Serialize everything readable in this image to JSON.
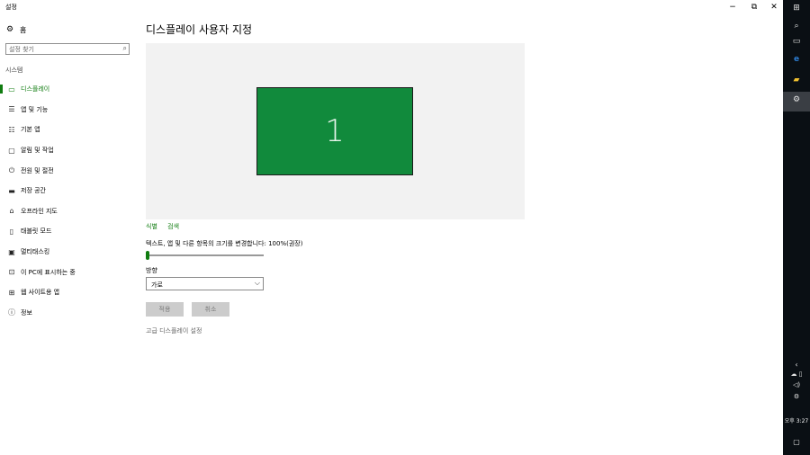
{
  "window": {
    "app_title": "설정",
    "minimize": "−",
    "restore": "⧉",
    "close": "✕"
  },
  "sidebar": {
    "home_label": "홈",
    "search_placeholder": "설정 찾기",
    "section_label": "시스템",
    "items": [
      {
        "label": "디스플레이",
        "icon": "monitor-icon",
        "active": true
      },
      {
        "label": "앱 및 기능",
        "icon": "list-icon"
      },
      {
        "label": "기본 앱",
        "icon": "list-bullet-icon"
      },
      {
        "label": "알림 및 작업",
        "icon": "message-icon"
      },
      {
        "label": "전원 및 절전",
        "icon": "power-icon"
      },
      {
        "label": "저장 공간",
        "icon": "storage-icon"
      },
      {
        "label": "오프라인 지도",
        "icon": "map-icon"
      },
      {
        "label": "태블릿 모드",
        "icon": "tablet-icon"
      },
      {
        "label": "멀티태스킹",
        "icon": "multitask-icon"
      },
      {
        "label": "이 PC에 표시하는 중",
        "icon": "project-icon"
      },
      {
        "label": "웹 사이트용 앱",
        "icon": "web-app-icon"
      },
      {
        "label": "정보",
        "icon": "info-icon"
      }
    ]
  },
  "main": {
    "page_title": "디스플레이 사용자 지정",
    "monitor_number": "1",
    "identify_link": "식별",
    "detect_link": "검색",
    "scale_label": "텍스트, 앱 및 다른 항목의 크기를 변경합니다: 100%(권장)",
    "scale_value_fraction": 0.0,
    "orientation_label": "방향",
    "orientation_value": "가로",
    "apply_button": "적용",
    "cancel_button": "취소",
    "advanced_link": "고급 디스플레이 설정"
  },
  "taskbar": {
    "clock": "오후 3:27"
  },
  "colors": {
    "accent": "#107c10",
    "monitor_fill": "#118a3c",
    "taskbar_bg": "#0a0f14"
  }
}
